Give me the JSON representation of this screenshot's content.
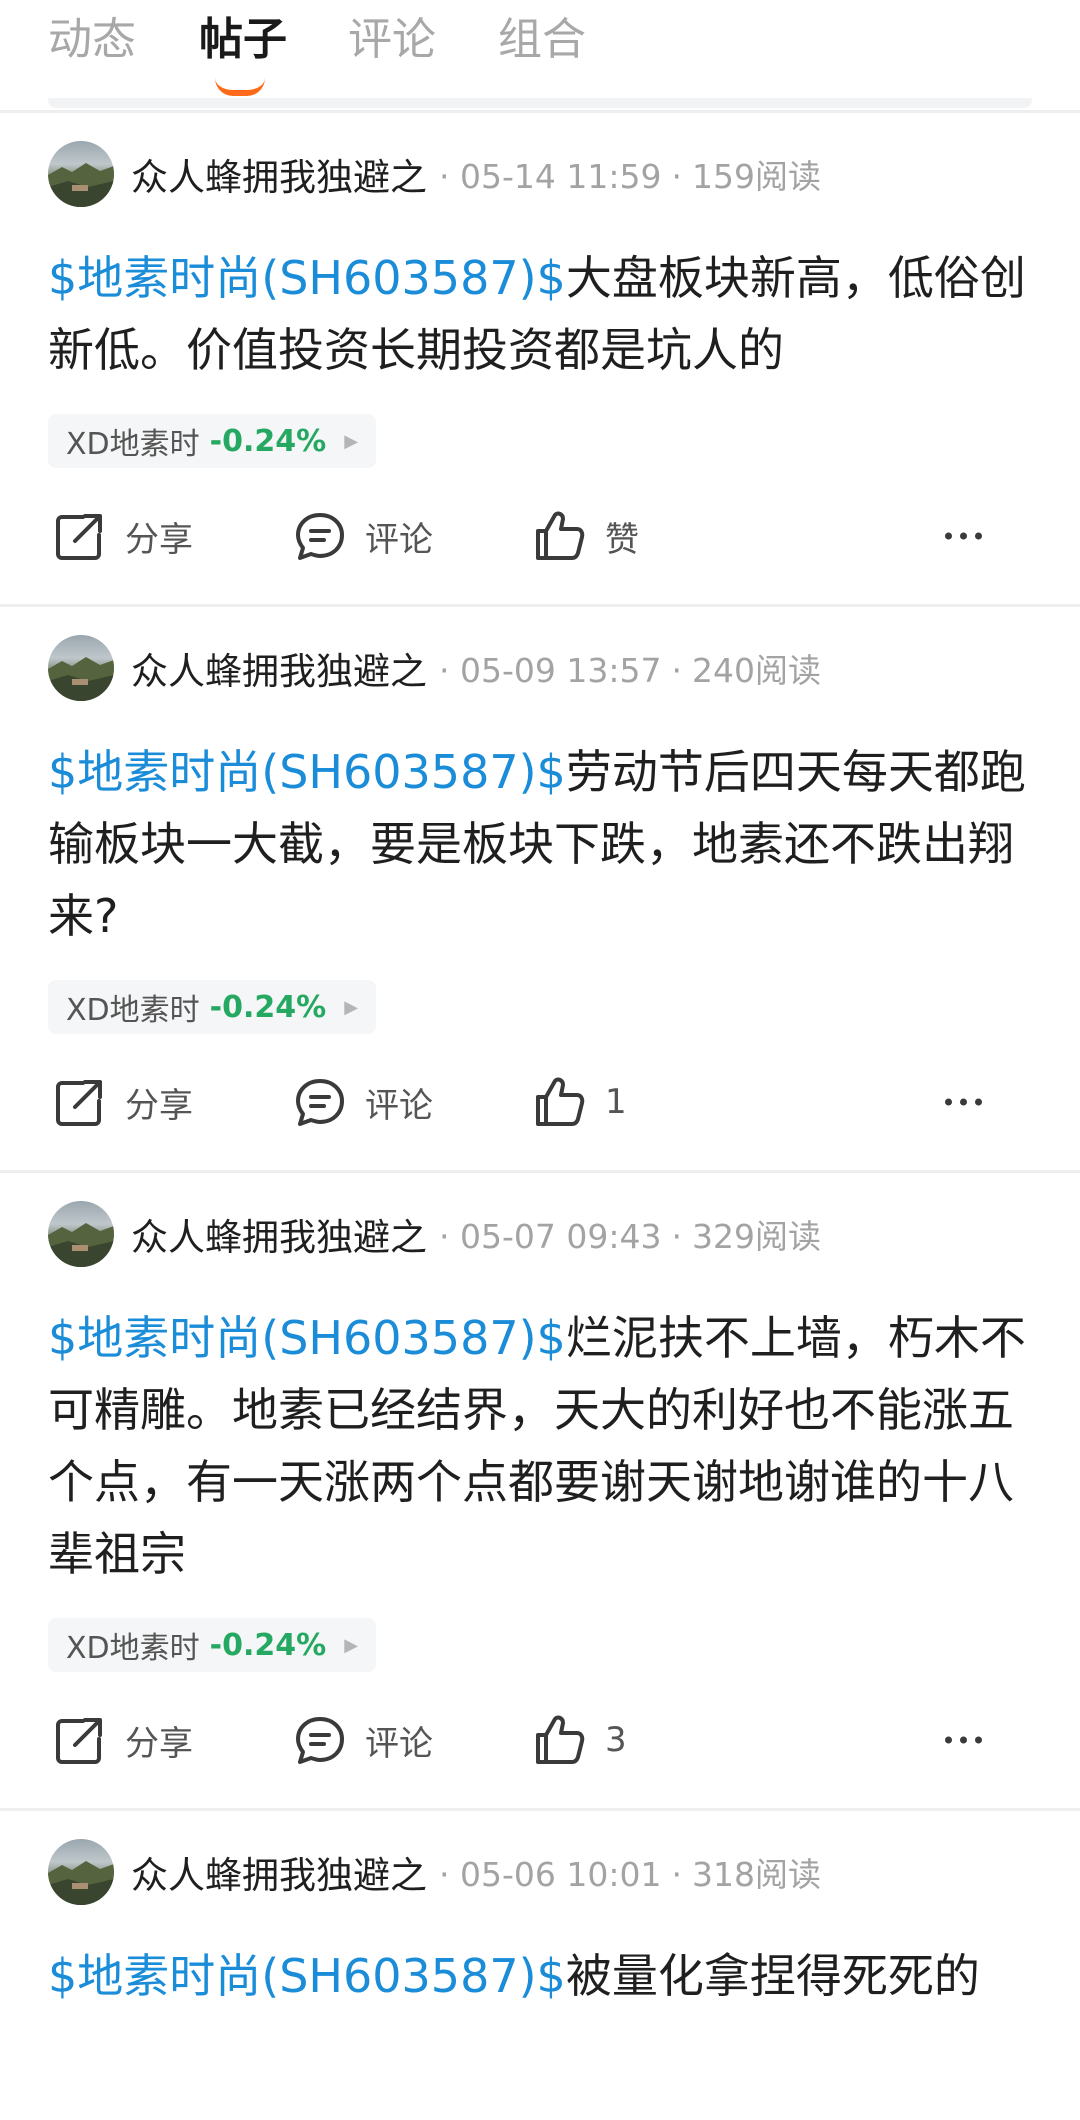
{
  "tabs": [
    {
      "label": "动态"
    },
    {
      "label": "帖子"
    },
    {
      "label": "评论"
    },
    {
      "label": "组合"
    }
  ],
  "actions": {
    "share": "分享",
    "comment": "评论"
  },
  "icons": {
    "share": "share-icon",
    "comment": "comment-icon",
    "like": "thumbs-up-icon",
    "more": "more-icon"
  },
  "colors": {
    "stock_link": "#1a8cd8",
    "positive_change": "#25a862",
    "tab_indicator": "#ff6a1a"
  },
  "posts": [
    {
      "author": "众人蜂拥我独避之",
      "date": "05-14 11:59",
      "reads": "159阅读",
      "stock_tag": "$地素时尚(SH603587)$",
      "text": "大盘板块新高，低俗创新低。价值投资长期投资都是坑人的",
      "chip_name": "XD地素时",
      "chip_change": "-0.24%",
      "like_label": "赞"
    },
    {
      "author": "众人蜂拥我独避之",
      "date": "05-09 13:57",
      "reads": "240阅读",
      "stock_tag": "$地素时尚(SH603587)$",
      "text": "劳动节后四天每天都跑输板块一大截，要是板块下跌，地素还不跌出翔来?",
      "chip_name": "XD地素时",
      "chip_change": "-0.24%",
      "like_label": "1"
    },
    {
      "author": "众人蜂拥我独避之",
      "date": "05-07 09:43",
      "reads": "329阅读",
      "stock_tag": "$地素时尚(SH603587)$",
      "text": "烂泥扶不上墙，朽木不可精雕。地素已经结界，天大的利好也不能涨五个点，有一天涨两个点都要谢天谢地谢谁的十八辈祖宗",
      "chip_name": "XD地素时",
      "chip_change": "-0.24%",
      "like_label": "3"
    },
    {
      "author": "众人蜂拥我独避之",
      "date": "05-06 10:01",
      "reads": "318阅读",
      "stock_tag": "$地素时尚(SH603587)$",
      "text": "被量化拿捏得死死的"
    }
  ]
}
